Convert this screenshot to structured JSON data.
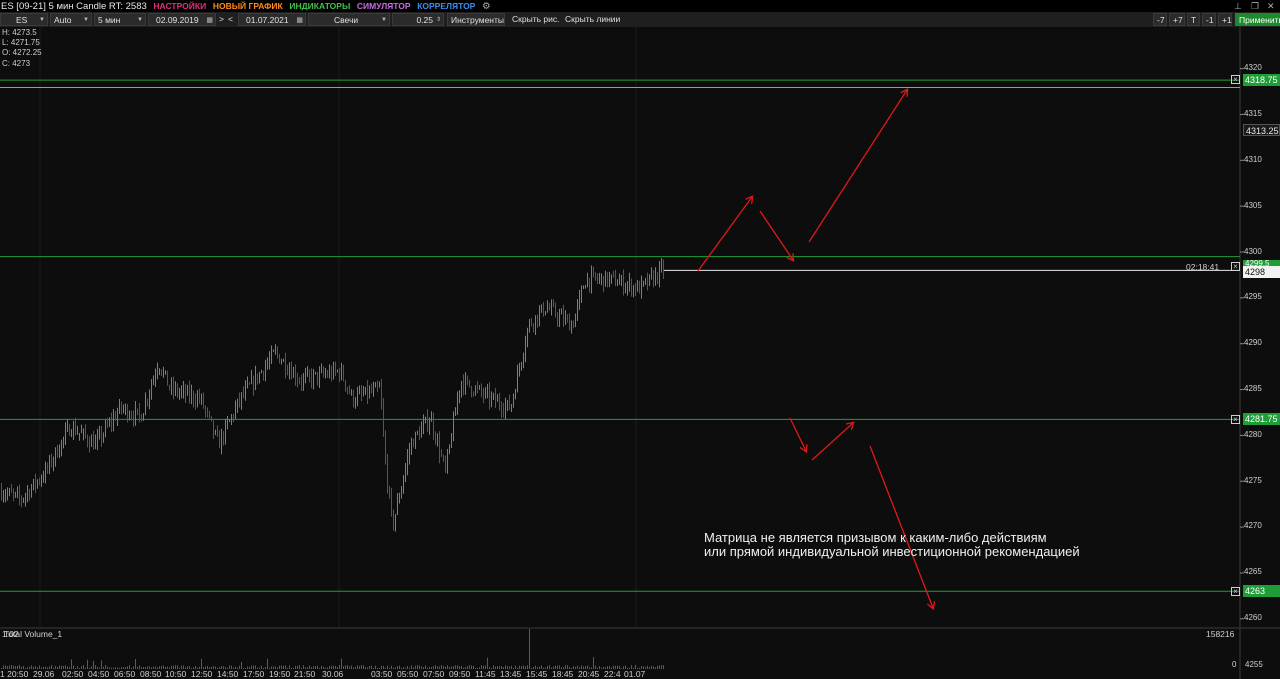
{
  "title": {
    "text": "ES [09-21] 5 мин Candle RT: 2583",
    "menus": [
      {
        "label": "НАСТРОЙКИ",
        "color": "#e0307a"
      },
      {
        "label": "НОВЫЙ ГРАФИК",
        "color": "#ff8a1e"
      },
      {
        "label": "ИНДИКАТОРЫ",
        "color": "#3fc24a"
      },
      {
        "label": "СИМУЛЯТОР",
        "color": "#c86de0"
      },
      {
        "label": "КОРРЕЛЯТОР",
        "color": "#3a8ff0"
      }
    ],
    "icons": [
      "gear-icon",
      "pin-icon",
      "restore-icon",
      "close-icon"
    ]
  },
  "toolbar": {
    "symbol": "ES",
    "scale": "Auto",
    "timeframe": "5 мин",
    "date_from": "02.09.2019",
    "nav_next": ">",
    "nav_prev": "<",
    "date_to": "01.07.2021",
    "chart_type": "Свечи",
    "tick_size": "0.25",
    "instruments": "Инструменты",
    "hide_drawings": "Скрыть рис.",
    "hide_lines": "Скрыть линии",
    "minus7": "-7",
    "plus7": "+7",
    "t": "T",
    "minus1": "-1",
    "plus1": "+1",
    "apply": "Применить"
  },
  "ohlc": {
    "h": "H: 4273.5",
    "l": "L: 4271.75",
    "o": "O: 4272.25",
    "c": "C: 4273"
  },
  "price_axis": {
    "labels": [
      "4320",
      "4315",
      "4310",
      "4305",
      "4300",
      "4295",
      "4290",
      "4285",
      "4280",
      "4275",
      "4270",
      "4265",
      "4260",
      "4255"
    ],
    "current_price": "4313.25",
    "current_bar_price": "4298",
    "timer": "02:18:41"
  },
  "levels": [
    {
      "value": "4318.75",
      "color": "#1f9e37"
    },
    {
      "value": "4281.75",
      "color": "#1f9e37"
    },
    {
      "value": "4263",
      "color": "#1f9e37"
    }
  ],
  "hidden_level": "4299.5",
  "disclaimer": {
    "line1": "Матрица не является призывом к каким-либо действиям",
    "line2": "или прямой индивидуальной инвестиционной рекомендацией"
  },
  "volume": {
    "label": "Total Volume_1",
    "label_prefix": "1:02",
    "max": "158216",
    "zero": "0"
  },
  "time_axis": {
    "labels": [
      "1 20:50",
      "29.06",
      "02:50",
      "04:50",
      "06:50",
      "08:50",
      "10:50",
      "12:50",
      "14:50",
      "17:50",
      "19:50",
      "21:50",
      "30.06",
      "03:50",
      "05:50",
      "07:50",
      "09:50",
      "11:45",
      "13:45",
      "15:45",
      "18:45",
      "20:45",
      "22:4",
      "01.07"
    ]
  },
  "colors": {
    "bull": "#2fb33c",
    "bear": "#d32020",
    "arrow": "#e01818",
    "level_line": "#1f9e37",
    "badge_bg": "#1f9e37"
  }
}
